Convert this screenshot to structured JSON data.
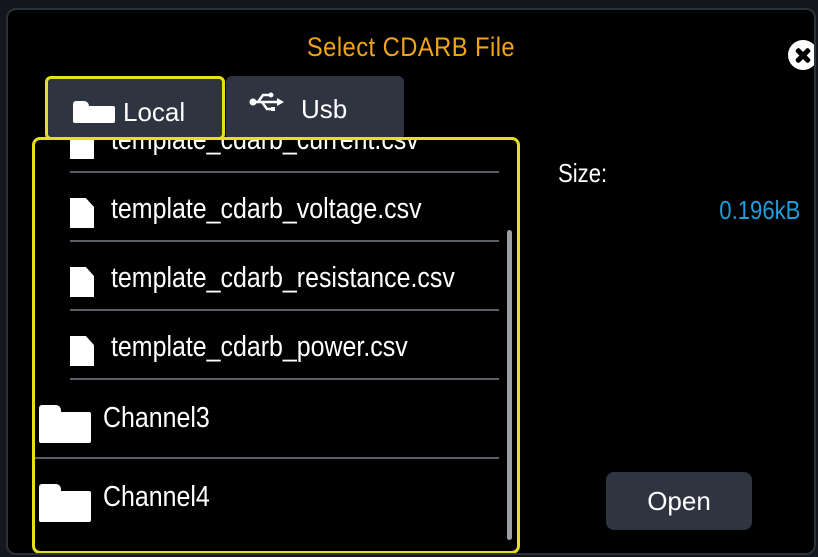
{
  "dialog": {
    "title": "Select CDARB File",
    "close_icon": "close-icon"
  },
  "tabs": [
    {
      "label": "Local",
      "icon": "folder-icon",
      "selected": true
    },
    {
      "label": "Usb",
      "icon": "usb-icon",
      "selected": false
    }
  ],
  "files": [
    {
      "name": "template_cdarb_current.csv",
      "icon": "file-icon"
    },
    {
      "name": "template_cdarb_voltage.csv",
      "icon": "file-icon"
    },
    {
      "name": "template_cdarb_resistance.csv",
      "icon": "file-icon"
    },
    {
      "name": "template_cdarb_power.csv",
      "icon": "file-icon"
    }
  ],
  "folders": [
    {
      "name": "Channel3",
      "icon": "folder-icon"
    },
    {
      "name": "Channel4",
      "icon": "folder-icon"
    }
  ],
  "info": {
    "size_label": "Size:",
    "size_value": "0.196kB"
  },
  "actions": {
    "open_label": "Open"
  },
  "colors": {
    "title": "#f0a41a",
    "highlight_border": "#e6df1e",
    "size_value": "#1e9ed8",
    "button_bg": "#2e3440"
  }
}
